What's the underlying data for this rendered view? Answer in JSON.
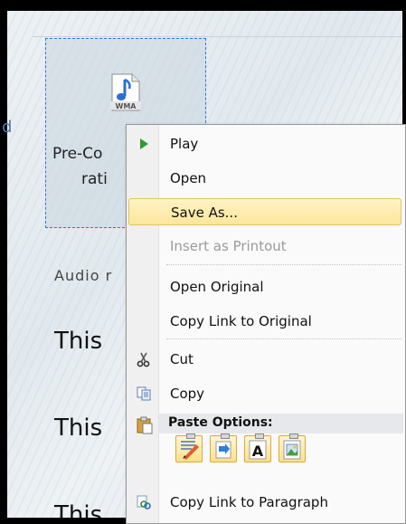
{
  "document": {
    "file_icon_label": "WMA",
    "file_name_line1": "Pre-Co",
    "file_name_line2": "rati",
    "audio_line": "Audio r",
    "body_lines": [
      "This",
      "This",
      "This"
    ],
    "left_marker": "d"
  },
  "context_menu": {
    "items": [
      {
        "label": "Play",
        "icon": "play-icon",
        "state": "normal"
      },
      {
        "label": "Open",
        "icon": "",
        "state": "normal"
      },
      {
        "label": "Save As...",
        "icon": "",
        "state": "hover"
      },
      {
        "label": "Insert as Printout",
        "icon": "",
        "state": "disabled"
      },
      {
        "label": "Open Original",
        "icon": "",
        "state": "normal"
      },
      {
        "label": "Copy Link to Original",
        "icon": "",
        "state": "normal"
      },
      {
        "label": "Cut",
        "icon": "scissors-icon",
        "state": "normal"
      },
      {
        "label": "Copy",
        "icon": "copy-icon",
        "state": "normal"
      },
      {
        "label": "Copy Link to Paragraph",
        "icon": "link-icon",
        "state": "normal"
      }
    ],
    "paste_options_header": "Paste Options:",
    "paste_buttons": [
      "keep-source-formatting-icon",
      "merge-formatting-icon",
      "keep-text-only-icon",
      "paste-picture-icon"
    ],
    "text_only_glyph": "A"
  },
  "colors": {
    "hover_fill": "#fce69b",
    "selection_border": "#2a79d6",
    "play_green": "#2e9b2e",
    "disabled_text": "#9a9a9a"
  }
}
